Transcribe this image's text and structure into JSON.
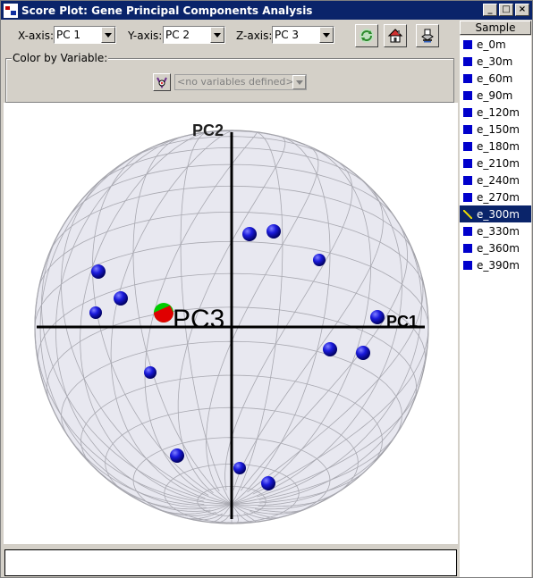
{
  "window": {
    "title": "Score Plot: Gene Principal Components Analysis",
    "buttons": [
      "_",
      "□",
      "×"
    ]
  },
  "toolbar": {
    "x_axis": {
      "label": "X-axis:",
      "value": "PC 1"
    },
    "y_axis": {
      "label": "Y-axis:",
      "value": "PC 2"
    },
    "z_axis": {
      "label": "Z-axis:",
      "value": "PC 3"
    },
    "tools": [
      "refresh-icon",
      "home-icon",
      "print-icon"
    ]
  },
  "color_by": {
    "title": "Color by Variable:",
    "value": "<no variables defined>",
    "icon": "palette-icon"
  },
  "plot": {
    "axis_labels": {
      "pc1": "PC1",
      "pc2": "PC2",
      "pc3": "PC3"
    },
    "colors": {
      "point": "#1a1adc",
      "highlight_a": "#00cc00",
      "highlight_b": "#e00000"
    }
  },
  "sample_panel": {
    "header": "Sample",
    "items": [
      "e_0m",
      "e_30m",
      "e_60m",
      "e_90m",
      "e_120m",
      "e_150m",
      "e_180m",
      "e_210m",
      "e_240m",
      "e_270m",
      "e_300m",
      "e_330m",
      "e_360m",
      "e_390m"
    ],
    "selected": "e_300m",
    "swatch_color": "#0000cc"
  },
  "status": {
    "text": ""
  }
}
